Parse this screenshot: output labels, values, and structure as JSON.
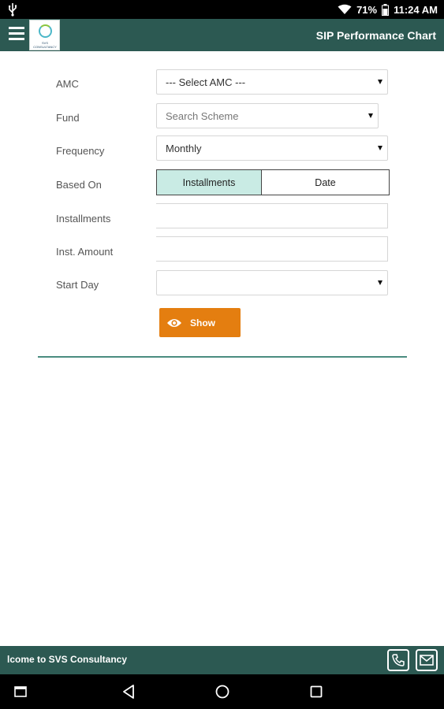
{
  "status_bar": {
    "battery": "71%",
    "time": "11:24 AM",
    "icons": [
      "usb-icon",
      "wifi-icon",
      "battery-icon"
    ]
  },
  "app_bar": {
    "title": "SIP Performance Chart",
    "logo_text": "SVS CONSULTANCY",
    "icons": [
      "menu-icon",
      "logo"
    ]
  },
  "form": {
    "amc": {
      "label": "AMC",
      "value": "--- Select AMC ---"
    },
    "fund": {
      "label": "Fund",
      "placeholder": "Search Scheme"
    },
    "frequency": {
      "label": "Frequency",
      "value": "Monthly"
    },
    "based_on": {
      "label": "Based On",
      "options": [
        "Installments",
        "Date"
      ],
      "selected": "Installments"
    },
    "installments": {
      "label": "Installments",
      "value": ""
    },
    "inst_amount": {
      "label": "Inst. Amount",
      "value": ""
    },
    "start_day": {
      "label": "Start Day",
      "value": ""
    },
    "show_button": {
      "label": "Show",
      "icon": "eye-icon"
    }
  },
  "footer": {
    "marquee": "lcome to SVS Consultancy",
    "icons": [
      "phone-icon",
      "mail-icon"
    ]
  },
  "nav_bar": {
    "icons": [
      "screenshot-icon",
      "back-icon",
      "home-icon",
      "recents-icon"
    ]
  },
  "colors": {
    "primary": "#2c5952",
    "accent": "#e47e10",
    "segment_active": "#c9ebe4",
    "divider": "#4a8c80"
  }
}
